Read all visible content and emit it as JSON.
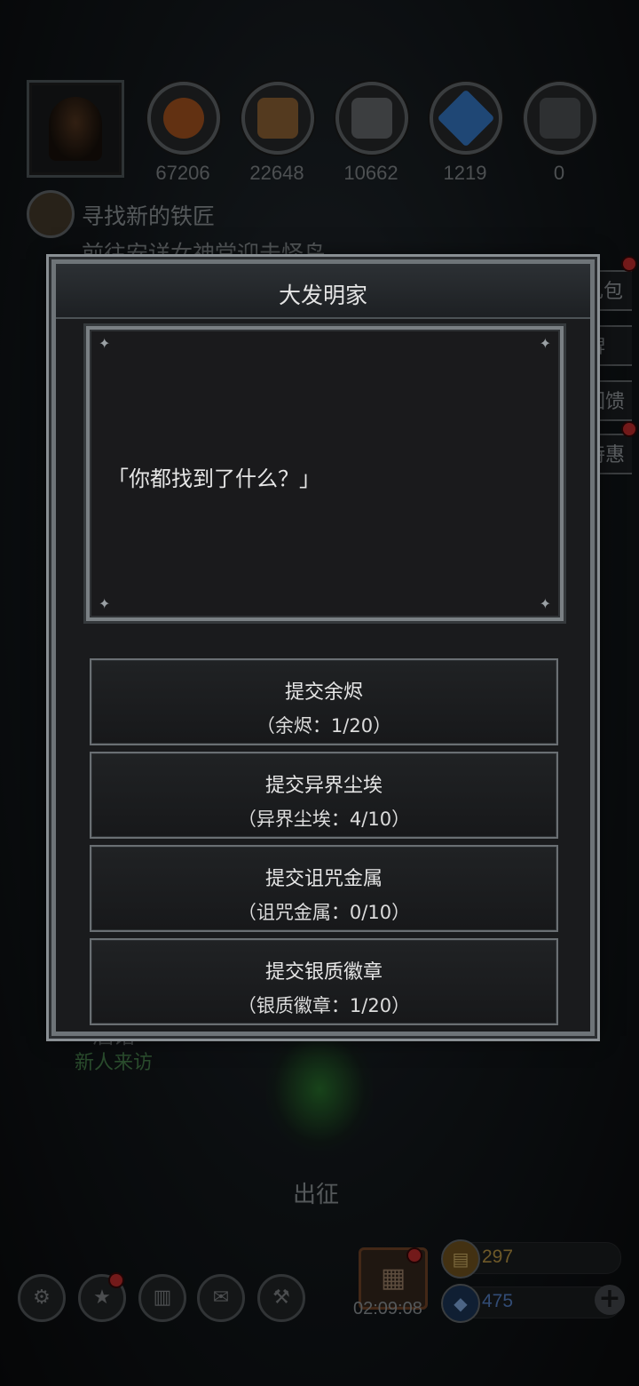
{
  "resources": [
    {
      "name": "meat-icon",
      "value": "67206",
      "color": "#b25a22"
    },
    {
      "name": "wood-icon",
      "value": "22648",
      "color": "#9a6a3a"
    },
    {
      "name": "iron-icon",
      "value": "10662",
      "color": "#6e7276"
    },
    {
      "name": "crystal-icon",
      "value": "1219",
      "color": "#3a82d6"
    },
    {
      "name": "metal-icon",
      "value": "0",
      "color": "#55585c"
    }
  ],
  "quest": {
    "title": "寻找新的铁匠",
    "subtitle": "前往安详女神堂迎击怪鸟"
  },
  "side_buttons": [
    "礼包",
    "牌",
    "回馈",
    "特惠"
  ],
  "background": {
    "tavern": "酒馆",
    "tavern_sub": "新人来访",
    "expedition": "出征"
  },
  "dialog": {
    "title": "大发明家",
    "message": "「你都找到了什么？」",
    "choices": [
      {
        "label": "提交余烬",
        "progress": "（余烬：1/20）"
      },
      {
        "label": "提交异界尘埃",
        "progress": "（异界尘埃：4/10）"
      },
      {
        "label": "提交诅咒金属",
        "progress": "（诅咒金属：0/10）"
      },
      {
        "label": "提交银质徽章",
        "progress": "（银质徽章：1/20）"
      }
    ]
  },
  "bottom_bar": {
    "timer": "02:09:08",
    "gold": "297",
    "gems": "475"
  },
  "colors": {
    "gold": "#c9a24a",
    "gems": "#5b8ad6"
  }
}
